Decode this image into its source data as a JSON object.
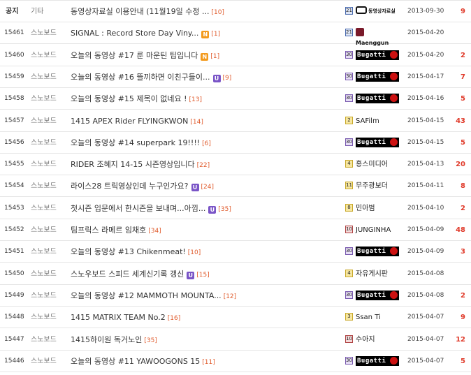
{
  "rows": [
    {
      "num": "공지",
      "cat": "기타",
      "title": "동영상자료실 이용안내 (11월19일 수정 ...",
      "badge": "",
      "comments": "[10]",
      "level": "21",
      "writer_type": "cam",
      "writer": "동영상자료실",
      "date": "2013-09-30",
      "hits": "9"
    },
    {
      "num": "15461",
      "cat": "스노보드",
      "title": "SIGNAL : Record Store Day Viny...",
      "badge": "N",
      "comments": "[1]",
      "level": "21",
      "writer_type": "mang",
      "writer": "Maenggun",
      "date": "2015-04-20",
      "hits": ""
    },
    {
      "num": "15460",
      "cat": "스노보드",
      "title": "오늘의 동영상 #17 룬 마운틴 팁입니다",
      "badge": "N",
      "comments": "[1]",
      "level": "30",
      "writer_type": "bug",
      "writer": "Bugatti",
      "date": "2015-04-20",
      "hits": "2"
    },
    {
      "num": "15459",
      "cat": "스노보드",
      "title": "오늘의 동영상 #16 뜰끼하면 이친구들이...",
      "badge": "U",
      "comments": "[9]",
      "level": "30",
      "writer_type": "bug",
      "writer": "Bugatti",
      "date": "2015-04-17",
      "hits": "7"
    },
    {
      "num": "15458",
      "cat": "스노보드",
      "title": "오늘의 동영상 #15 제목이 없네요 !",
      "badge": "",
      "comments": "[13]",
      "level": "30",
      "writer_type": "bug",
      "writer": "Bugatti",
      "date": "2015-04-16",
      "hits": "5"
    },
    {
      "num": "15457",
      "cat": "스노보드",
      "title": "1415 APEX Rider FLYINGKWON",
      "badge": "",
      "comments": "[14]",
      "level": "2",
      "writer_type": "text",
      "writer": "SAFilm",
      "date": "2015-04-15",
      "hits": "43"
    },
    {
      "num": "15456",
      "cat": "스노보드",
      "title": "오늘의 동영상 #14 superpark 19!!!!",
      "badge": "",
      "comments": "[6]",
      "level": "30",
      "writer_type": "bug",
      "writer": "Bugatti",
      "date": "2015-04-15",
      "hits": "5"
    },
    {
      "num": "15455",
      "cat": "스노보드",
      "title": "RIDER 조혜지 14-15 시즌영상입니다",
      "badge": "",
      "comments": "[22]",
      "level": "4",
      "writer_type": "text",
      "writer": "홍스미디어",
      "date": "2015-04-13",
      "hits": "20"
    },
    {
      "num": "15454",
      "cat": "스노보드",
      "title": "라이스28 트릭영상인데 누구인가요?",
      "badge": "U",
      "comments": "[24]",
      "level": "11",
      "writer_type": "text",
      "writer": "무주광보더",
      "date": "2015-04-11",
      "hits": "8"
    },
    {
      "num": "15453",
      "cat": "스노보드",
      "title": "첫시즌 입문에서 한시즌을 보내며...아낌...",
      "badge": "U",
      "comments": "[35]",
      "level": "8",
      "writer_type": "text",
      "writer": "민아범",
      "date": "2015-04-10",
      "hits": "2"
    },
    {
      "num": "15452",
      "cat": "스노보드",
      "title": "팀프릭스 라메르 임채호",
      "badge": "",
      "comments": "[34]",
      "level": "10",
      "writer_type": "text",
      "writer": "JUNGINHA",
      "date": "2015-04-09",
      "hits": "48"
    },
    {
      "num": "15451",
      "cat": "스노보드",
      "title": "오늘의 동영상 #13 Chikenmeat!",
      "badge": "",
      "comments": "[10]",
      "level": "30",
      "writer_type": "bug",
      "writer": "Bugatti",
      "date": "2015-04-09",
      "hits": "3"
    },
    {
      "num": "15450",
      "cat": "스노보드",
      "title": "스노우보드 스피드 세계신기록 갱신",
      "badge": "U",
      "comments": "[15]",
      "level": "4",
      "writer_type": "text",
      "writer": "자유게시판",
      "date": "2015-04-08",
      "hits": ""
    },
    {
      "num": "15449",
      "cat": "스노보드",
      "title": "오늘의 동영상 #12 MAMMOTH MOUNTA...",
      "badge": "",
      "comments": "[12]",
      "level": "30",
      "writer_type": "bug",
      "writer": "Bugatti",
      "date": "2015-04-08",
      "hits": "2"
    },
    {
      "num": "15448",
      "cat": "스노보드",
      "title": "1415 MATRIX TEAM No.2",
      "badge": "",
      "comments": "[16]",
      "level": "3",
      "writer_type": "text",
      "writer": "Ssan Ti",
      "date": "2015-04-07",
      "hits": "9"
    },
    {
      "num": "15447",
      "cat": "스노보드",
      "title": "1415하이원 독거노인",
      "badge": "",
      "comments": "[35]",
      "level": "10",
      "writer_type": "text",
      "writer": "수아지",
      "date": "2015-04-07",
      "hits": "12"
    },
    {
      "num": "15446",
      "cat": "스노보드",
      "title": "오늘의 동영상 #11 YAWOOGONS 15",
      "badge": "",
      "comments": "[11]",
      "level": "30",
      "writer_type": "bug",
      "writer": "Bugatti",
      "date": "2015-04-07",
      "hits": "5"
    }
  ],
  "colors": {
    "comment": "#e05a2b",
    "hits": "#e03b2b",
    "badge_n": "#f39a1d",
    "badge_u": "#7a55c7"
  }
}
